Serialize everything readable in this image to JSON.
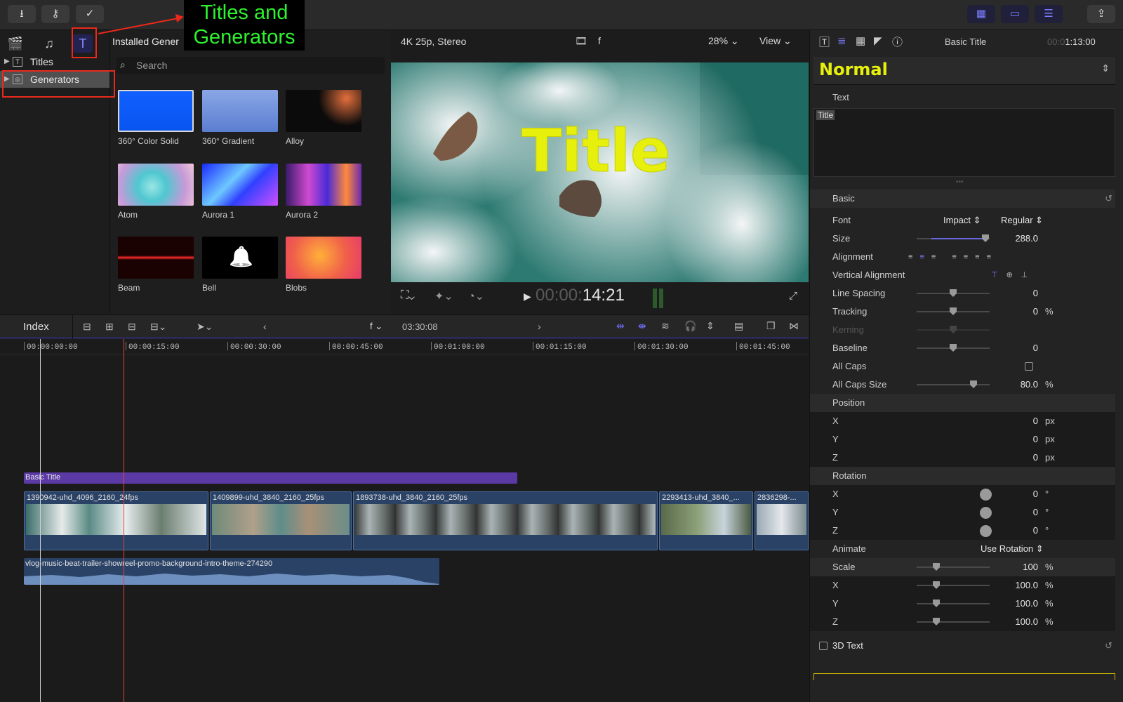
{
  "annotation": {
    "line1": "Titles and",
    "line2": "Generators"
  },
  "toolbar": {
    "import_icon": "download-icon",
    "keywords_icon": "key-icon",
    "check_icon": "check-circle-icon"
  },
  "sidebar": {
    "items": [
      {
        "label": "Titles"
      },
      {
        "label": "Generators"
      }
    ]
  },
  "browser": {
    "header": "Installed Gener",
    "search_placeholder": "Search",
    "items": [
      {
        "label": "360° Color Solid",
        "color": "#1060ff"
      },
      {
        "label": "360° Gradient",
        "color": "#6f8fd6"
      },
      {
        "label": "Alloy",
        "color": "#0b0b0b"
      },
      {
        "label": "Atom",
        "color": "#5fd6d8"
      },
      {
        "label": "Aurora 1",
        "color": "#2a55ff"
      },
      {
        "label": "Aurora 2",
        "color": "#8a2bd6"
      },
      {
        "label": "Beam",
        "color": "#1a0202"
      },
      {
        "label": "Bell",
        "color": "#000000"
      },
      {
        "label": "Blobs",
        "color": "#f0504a"
      }
    ]
  },
  "viewer": {
    "format": "4K 25p, Stereo",
    "f_label": "f",
    "zoom": "28%",
    "view": "View",
    "title_text": "Title",
    "timecode_dim": "00:00:",
    "timecode": "14:21"
  },
  "timeline": {
    "index": "Index",
    "f_label": "f",
    "duration": "03:30:08",
    "ruler": [
      "00:00:00:00",
      "00:00:15:00",
      "00:00:30:00",
      "00:00:45:00",
      "00:01:00:00",
      "00:01:15:00",
      "00:01:30:00",
      "00:01:45:00"
    ],
    "title_clip": "Basic Title",
    "clips": [
      "1390942-uhd_4096_2160_24fps",
      "1409899-uhd_3840_2160_25fps",
      "1893738-uhd_3840_2160_25fps",
      "2293413-uhd_3840_...",
      "2836298-..."
    ],
    "audio_clip": "vlog-music-beat-trailer-showreel-promo-background-intro-theme-274290"
  },
  "inspector": {
    "title": "Basic Title",
    "time_dim": "00:0",
    "time": "1:13:00",
    "preset": "Normal",
    "text_label": "Text",
    "text_value": "Title",
    "basic_label": "Basic",
    "rows": {
      "font": {
        "label": "Font",
        "family": "Impact",
        "style": "Regular"
      },
      "size": {
        "label": "Size",
        "value": "288.0"
      },
      "alignment": {
        "label": "Alignment"
      },
      "valign": {
        "label": "Vertical Alignment"
      },
      "line_spacing": {
        "label": "Line Spacing",
        "value": "0"
      },
      "tracking": {
        "label": "Tracking",
        "value": "0",
        "unit": "%"
      },
      "kerning": {
        "label": "Kerning"
      },
      "baseline": {
        "label": "Baseline",
        "value": "0"
      },
      "all_caps": {
        "label": "All Caps"
      },
      "all_caps_size": {
        "label": "All Caps Size",
        "value": "80.0",
        "unit": "%"
      },
      "position": {
        "label": "Position"
      },
      "pos_x": {
        "label": "X",
        "value": "0",
        "unit": "px"
      },
      "pos_y": {
        "label": "Y",
        "value": "0",
        "unit": "px"
      },
      "pos_z": {
        "label": "Z",
        "value": "0",
        "unit": "px"
      },
      "rotation": {
        "label": "Rotation"
      },
      "rot_x": {
        "label": "X",
        "value": "0",
        "unit": "°"
      },
      "rot_y": {
        "label": "Y",
        "value": "0",
        "unit": "°"
      },
      "rot_z": {
        "label": "Z",
        "value": "0",
        "unit": "°"
      },
      "animate": {
        "label": "Animate",
        "value": "Use Rotation"
      },
      "scale": {
        "label": "Scale",
        "value": "100",
        "unit": "%"
      },
      "scale_x": {
        "label": "X",
        "value": "100.0",
        "unit": "%"
      },
      "scale_y": {
        "label": "Y",
        "value": "100.0",
        "unit": "%"
      },
      "scale_z": {
        "label": "Z",
        "value": "100.0",
        "unit": "%"
      },
      "text3d": {
        "label": "3D Text"
      }
    }
  }
}
